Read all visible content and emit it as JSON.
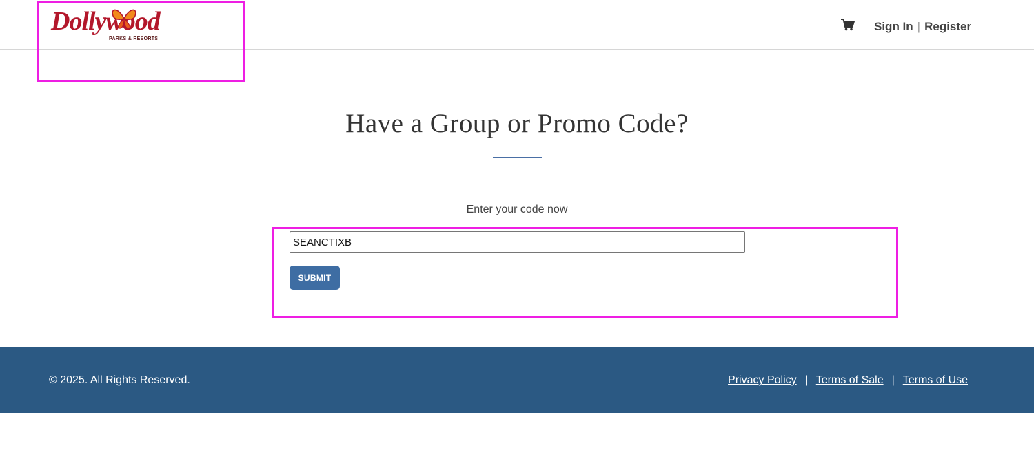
{
  "header": {
    "logo": {
      "brand": "Dollywood",
      "subtitle": "PARKS & RESORTS"
    },
    "cart_icon": "cart-icon",
    "sign_in_label": "Sign In",
    "separator": "|",
    "register_label": "Register"
  },
  "main": {
    "title": "Have a Group or Promo Code?",
    "prompt": "Enter your code now",
    "code_input": {
      "value": "SEANCTIXB",
      "placeholder": ""
    },
    "submit_label": "SUBMIT"
  },
  "footer": {
    "copyright": "© 2025. All Rights Reserved.",
    "links": {
      "privacy_policy": "Privacy Policy",
      "terms_of_sale": "Terms of Sale",
      "terms_of_use": "Terms of Use",
      "separator": "|"
    }
  },
  "colors": {
    "brand_red": "#b3172b",
    "accent_blue": "#3e6da3",
    "footer_blue": "#2b5983",
    "highlight_magenta": "#ee1ee3"
  }
}
